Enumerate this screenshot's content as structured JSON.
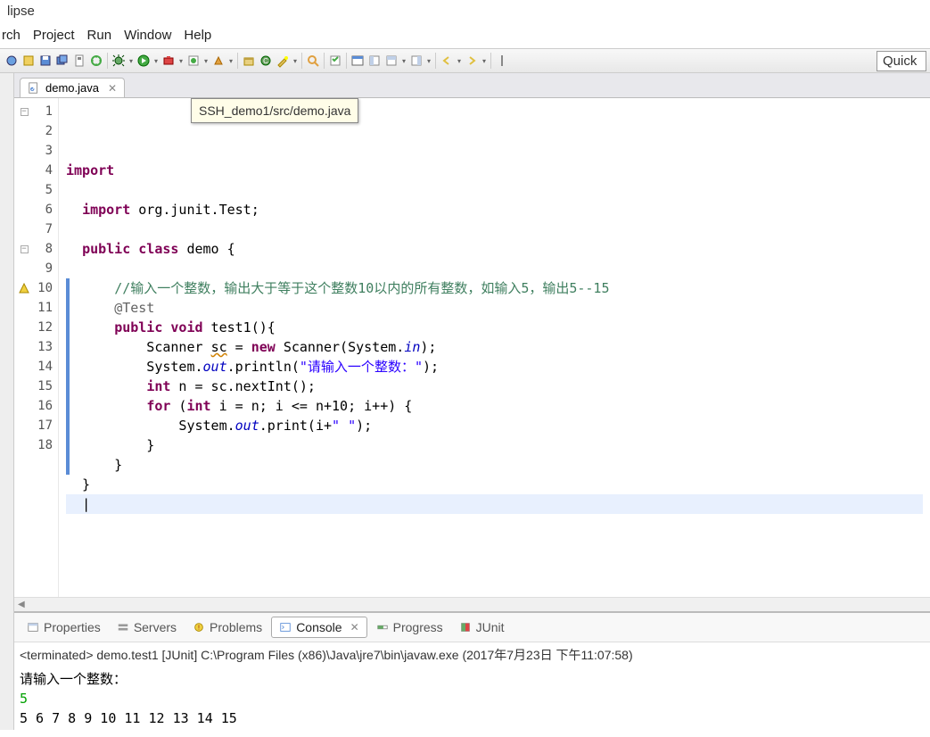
{
  "window": {
    "title": "lipse"
  },
  "menu": {
    "items": [
      "rch",
      "Project",
      "Run",
      "Window",
      "Help"
    ]
  },
  "quick": {
    "text": "Quick"
  },
  "tabs": {
    "editor": {
      "filename": "demo.java"
    }
  },
  "tooltip": {
    "text": "SSH_demo1/src/demo.java"
  },
  "code": {
    "lines": [
      {
        "n": 1,
        "marker": "fold",
        "segs": [
          {
            "t": "import",
            "c": "kw"
          }
        ]
      },
      {
        "n": 2,
        "segs": []
      },
      {
        "n": 3,
        "segs": [
          {
            "t": "  ",
            "c": ""
          },
          {
            "t": "import",
            "c": "kw"
          },
          {
            "t": " org.junit.Test;",
            "c": ""
          }
        ]
      },
      {
        "n": 4,
        "segs": []
      },
      {
        "n": 5,
        "segs": [
          {
            "t": "  ",
            "c": ""
          },
          {
            "t": "public",
            "c": "kw"
          },
          {
            "t": " ",
            "c": ""
          },
          {
            "t": "class",
            "c": "kw"
          },
          {
            "t": " demo {",
            "c": ""
          }
        ]
      },
      {
        "n": 6,
        "segs": []
      },
      {
        "n": 7,
        "bar": true,
        "segs": [
          {
            "t": "      ",
            "c": ""
          },
          {
            "t": "//输入一个整数，输出大于等于这个整数10以内的所有整数，如输入5，输出5--15",
            "c": "cm"
          }
        ]
      },
      {
        "n": 8,
        "bar": true,
        "marker": "fold",
        "segs": [
          {
            "t": "      ",
            "c": ""
          },
          {
            "t": "@Test",
            "c": "ann"
          }
        ]
      },
      {
        "n": 9,
        "bar": true,
        "segs": [
          {
            "t": "      ",
            "c": ""
          },
          {
            "t": "public",
            "c": "kw"
          },
          {
            "t": " ",
            "c": ""
          },
          {
            "t": "void",
            "c": "kw"
          },
          {
            "t": " test1(){",
            "c": ""
          }
        ]
      },
      {
        "n": 10,
        "bar": true,
        "marker": "warn",
        "segs": [
          {
            "t": "          Scanner ",
            "c": ""
          },
          {
            "t": "sc",
            "c": "err-underline"
          },
          {
            "t": " = ",
            "c": ""
          },
          {
            "t": "new",
            "c": "kw"
          },
          {
            "t": " Scanner(System.",
            "c": ""
          },
          {
            "t": "in",
            "c": "sfield"
          },
          {
            "t": ");",
            "c": ""
          }
        ]
      },
      {
        "n": 11,
        "bar": true,
        "segs": [
          {
            "t": "          System.",
            "c": ""
          },
          {
            "t": "out",
            "c": "sfield"
          },
          {
            "t": ".println(",
            "c": ""
          },
          {
            "t": "\"请输入一个整数：\"",
            "c": "str"
          },
          {
            "t": ");",
            "c": ""
          }
        ]
      },
      {
        "n": 12,
        "bar": true,
        "segs": [
          {
            "t": "          ",
            "c": ""
          },
          {
            "t": "int",
            "c": "kw"
          },
          {
            "t": " n = sc.nextInt();",
            "c": ""
          }
        ]
      },
      {
        "n": 13,
        "bar": true,
        "segs": [
          {
            "t": "          ",
            "c": ""
          },
          {
            "t": "for",
            "c": "kw"
          },
          {
            "t": " (",
            "c": ""
          },
          {
            "t": "int",
            "c": "kw"
          },
          {
            "t": " i = n; i <= n+10; i++) {",
            "c": ""
          }
        ]
      },
      {
        "n": 14,
        "bar": true,
        "segs": [
          {
            "t": "              System.",
            "c": ""
          },
          {
            "t": "out",
            "c": "sfield"
          },
          {
            "t": ".print(i+",
            "c": ""
          },
          {
            "t": "\" \"",
            "c": "str"
          },
          {
            "t": ");",
            "c": ""
          }
        ]
      },
      {
        "n": 15,
        "bar": true,
        "segs": [
          {
            "t": "          }",
            "c": ""
          }
        ]
      },
      {
        "n": 16,
        "bar": true,
        "segs": [
          {
            "t": "      }",
            "c": ""
          }
        ]
      },
      {
        "n": 17,
        "segs": [
          {
            "t": "  }",
            "c": ""
          }
        ]
      },
      {
        "n": 18,
        "cursor": true,
        "segs": [
          {
            "t": "  ",
            "c": ""
          }
        ]
      }
    ]
  },
  "bottom": {
    "tabs": [
      {
        "label": "Properties",
        "icon": "props"
      },
      {
        "label": "Servers",
        "icon": "servers"
      },
      {
        "label": "Problems",
        "icon": "problems"
      },
      {
        "label": "Console",
        "icon": "console",
        "active": true
      },
      {
        "label": "Progress",
        "icon": "progress"
      },
      {
        "label": "JUnit",
        "icon": "junit"
      }
    ],
    "console": {
      "header": "<terminated> demo.test1 [JUnit] C:\\Program Files (x86)\\Java\\jre7\\bin\\javaw.exe (2017年7月23日 下午11:07:58)",
      "lines": [
        {
          "text": "请输入一个整数：",
          "kind": "out"
        },
        {
          "text": "5",
          "kind": "in"
        },
        {
          "text": "5  6  7  8  9  10  11  12  13  14  15  ",
          "kind": "out"
        }
      ]
    }
  },
  "toolbar_icons": [
    "breakpoint",
    "paint",
    "save",
    "saveall",
    "pin",
    "build",
    "sep",
    "debug",
    "drop",
    "run",
    "drop",
    "extrun",
    "drop",
    "extrun2",
    "drop",
    "ext3",
    "drop",
    "sep",
    "newpkg",
    "newcls",
    "wizard",
    "drop",
    "sep",
    "search",
    "sep",
    "tasks",
    "sep",
    "window",
    "pane",
    "pane2",
    "drop",
    "pane3",
    "drop",
    "sep",
    "back",
    "drop",
    "fwd",
    "drop",
    "sep",
    "bar"
  ]
}
